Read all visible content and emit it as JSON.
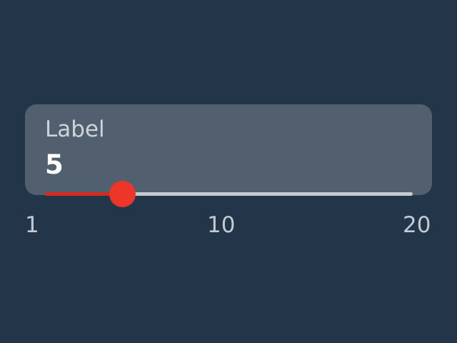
{
  "slider": {
    "label": "Label",
    "value_text": "5",
    "value": 5,
    "min": 1,
    "max": 20,
    "ticks": {
      "min": "1",
      "mid": "10",
      "max": "20"
    }
  },
  "colors": {
    "background": "#233549",
    "card": "#525f6e",
    "label_text": "#ccd3da",
    "value_text": "#ffffff",
    "track": "#c7cbd0",
    "fill": "#d42a20",
    "thumb": "#ed3529",
    "tick_text": "#c3cad2"
  }
}
